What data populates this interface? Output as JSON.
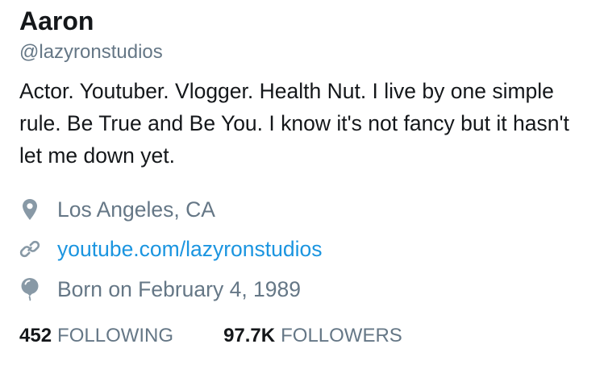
{
  "profile": {
    "name": "Aaron",
    "handle": "@lazyronstudios",
    "bio": "Actor. Youtuber. Vlogger. Health Nut. I live by one simple rule. Be True and Be You. I know it's not fancy but it hasn't let me down yet.",
    "location": "Los Angeles, CA",
    "website": "youtube.com/lazyronstudios",
    "birthday": "Born on February 4, 1989"
  },
  "stats": {
    "following_count": "452",
    "following_label": "FOLLOWING",
    "followers_count": "97.7K",
    "followers_label": "FOLLOWERS"
  },
  "icons": {
    "location": "location-pin-icon",
    "website": "link-icon",
    "birthday": "balloon-icon"
  },
  "colors": {
    "text": "#14171a",
    "secondary": "#657786",
    "link": "#1b95e0"
  }
}
